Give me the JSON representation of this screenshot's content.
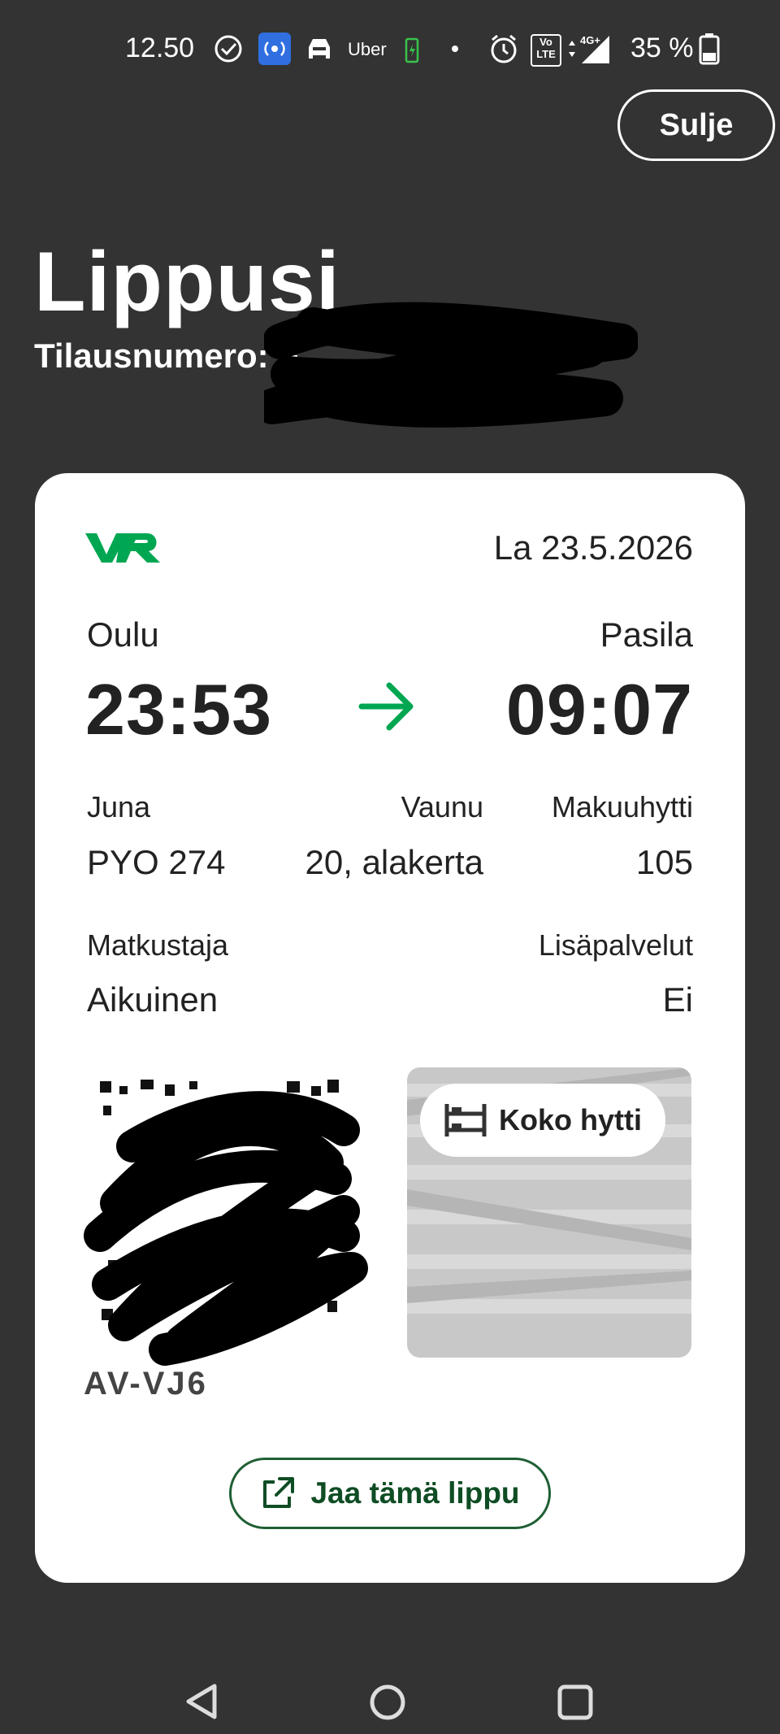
{
  "status_bar": {
    "time": "12.50",
    "carrier_app": "Uber",
    "network": "4G+",
    "battery": "35 %"
  },
  "header": {
    "close_label": "Sulje",
    "title": "Lippusi",
    "order_label": "Tilausnumero: F"
  },
  "ticket": {
    "brand": "VR",
    "date": "La 23.5.2026",
    "from_station": "Oulu",
    "to_station": "Pasila",
    "depart_time": "23:53",
    "arrive_time": "09:07",
    "train_label": "Juna",
    "train_value": "PYO 274",
    "car_label": "Vaunu",
    "car_value": "20, alakerta",
    "cabin_label": "Makuuhytti",
    "cabin_value": "105",
    "passenger_label": "Matkustaja",
    "passenger_value": "Aikuinen",
    "extras_label": "Lisäpalvelut",
    "extras_value": "Ei",
    "cabin_type": "Koko hytti",
    "ticket_code": "AV-VJ6",
    "share_label": "Jaa tämä lippu"
  },
  "colors": {
    "background": "#333333",
    "card": "#ffffff",
    "accent_green": "#00a651",
    "share_green": "#0f4d24"
  }
}
